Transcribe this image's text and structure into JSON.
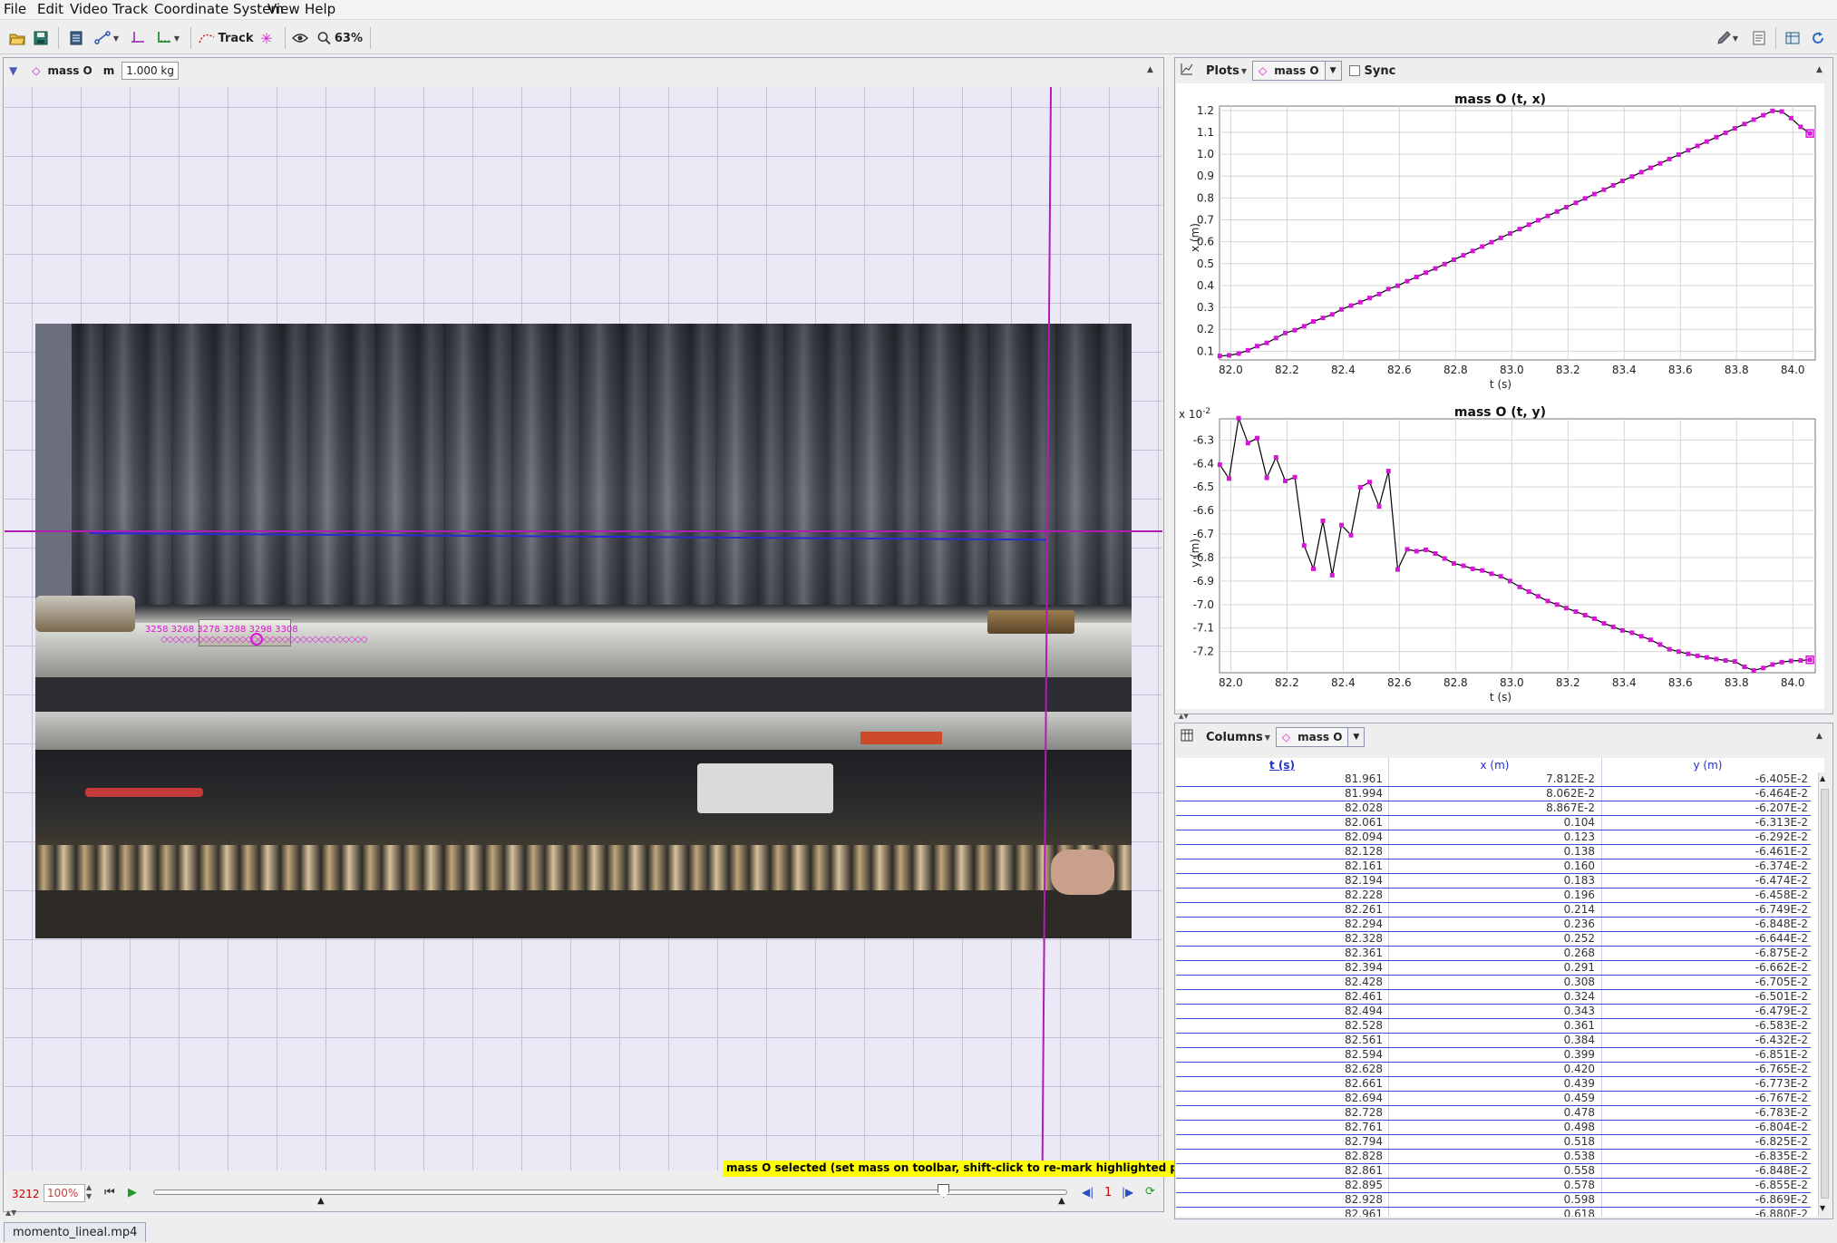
{
  "menubar": {
    "items": [
      "File",
      "Edit",
      "Video",
      "Track",
      "Coordinate System",
      "View",
      "Help"
    ]
  },
  "toolbar": {
    "track_label": "Track",
    "zoom_label": "63%"
  },
  "track_bar": {
    "track_name": "mass O",
    "mass_symbol": "m",
    "mass_value": "1.000 kg"
  },
  "canvas": {
    "point_labels": "3258 3268 3278 3288 3298 3308",
    "status_hint": "mass O selected (set mass on toolbar, shift-click to re-mark highlighted position)"
  },
  "player": {
    "frame_number": "3212",
    "rate": "100%",
    "step_size": "1"
  },
  "file_tab": "momento_lineal.mp4",
  "plots_bar": {
    "menu_label": "Plots",
    "track_name": "mass O",
    "sync_label": "Sync"
  },
  "columns_bar": {
    "menu_label": "Columns",
    "track_name": "mass O"
  },
  "plot1": {
    "title": "mass O (t, x)",
    "xlabel": "t (s)",
    "ylabel": "x (m)"
  },
  "plot2": {
    "title": "mass O (t, y)",
    "xlabel": "t (s)",
    "ylabel": "y (m)",
    "exponent_base": "x 10",
    "exponent_power": "-2"
  },
  "table": {
    "headers": [
      "t (s)",
      "x (m)",
      "y (m)"
    ],
    "rows": [
      [
        "81.961",
        "7.812E-2",
        "-6.405E-2"
      ],
      [
        "81.994",
        "8.062E-2",
        "-6.464E-2"
      ],
      [
        "82.028",
        "8.867E-2",
        "-6.207E-2"
      ],
      [
        "82.061",
        "0.104",
        "-6.313E-2"
      ],
      [
        "82.094",
        "0.123",
        "-6.292E-2"
      ],
      [
        "82.128",
        "0.138",
        "-6.461E-2"
      ],
      [
        "82.161",
        "0.160",
        "-6.374E-2"
      ],
      [
        "82.194",
        "0.183",
        "-6.474E-2"
      ],
      [
        "82.228",
        "0.196",
        "-6.458E-2"
      ],
      [
        "82.261",
        "0.214",
        "-6.749E-2"
      ],
      [
        "82.294",
        "0.236",
        "-6.848E-2"
      ],
      [
        "82.328",
        "0.252",
        "-6.644E-2"
      ],
      [
        "82.361",
        "0.268",
        "-6.875E-2"
      ],
      [
        "82.394",
        "0.291",
        "-6.662E-2"
      ],
      [
        "82.428",
        "0.308",
        "-6.705E-2"
      ],
      [
        "82.461",
        "0.324",
        "-6.501E-2"
      ],
      [
        "82.494",
        "0.343",
        "-6.479E-2"
      ],
      [
        "82.528",
        "0.361",
        "-6.583E-2"
      ],
      [
        "82.561",
        "0.384",
        "-6.432E-2"
      ],
      [
        "82.594",
        "0.399",
        "-6.851E-2"
      ],
      [
        "82.628",
        "0.420",
        "-6.765E-2"
      ],
      [
        "82.661",
        "0.439",
        "-6.773E-2"
      ],
      [
        "82.694",
        "0.459",
        "-6.767E-2"
      ],
      [
        "82.728",
        "0.478",
        "-6.783E-2"
      ],
      [
        "82.761",
        "0.498",
        "-6.804E-2"
      ],
      [
        "82.794",
        "0.518",
        "-6.825E-2"
      ],
      [
        "82.828",
        "0.538",
        "-6.835E-2"
      ],
      [
        "82.861",
        "0.558",
        "-6.848E-2"
      ],
      [
        "82.895",
        "0.578",
        "-6.855E-2"
      ],
      [
        "82.928",
        "0.598",
        "-6.869E-2"
      ],
      [
        "82.961",
        "0.618",
        "-6.880E-2"
      ]
    ]
  },
  "chart_data": [
    {
      "type": "line",
      "title": "mass O (t, x)",
      "xlabel": "t (s)",
      "ylabel": "x (m)",
      "xlim": [
        81.96,
        84.08
      ],
      "ylim": [
        0.06,
        1.22
      ],
      "xticks": [
        "82.0",
        "82.2",
        "82.4",
        "82.6",
        "82.8",
        "83.0",
        "83.2",
        "83.4",
        "83.6",
        "83.8",
        "84.0"
      ],
      "yticks": [
        "0.1",
        "0.2",
        "0.3",
        "0.4",
        "0.5",
        "0.6",
        "0.7",
        "0.8",
        "0.9",
        "1.0",
        "1.1",
        "1.2"
      ],
      "grid": true,
      "x": [
        81.961,
        81.994,
        82.028,
        82.061,
        82.094,
        82.128,
        82.161,
        82.194,
        82.228,
        82.261,
        82.294,
        82.328,
        82.361,
        82.394,
        82.428,
        82.461,
        82.494,
        82.528,
        82.561,
        82.594,
        82.628,
        82.661,
        82.694,
        82.728,
        82.761,
        82.794,
        82.828,
        82.861,
        82.895,
        82.928,
        82.961,
        82.994,
        83.028,
        83.061,
        83.094,
        83.128,
        83.161,
        83.194,
        83.228,
        83.261,
        83.294,
        83.328,
        83.361,
        83.394,
        83.428,
        83.461,
        83.494,
        83.528,
        83.561,
        83.594,
        83.628,
        83.661,
        83.694,
        83.728,
        83.761,
        83.794,
        83.828,
        83.861,
        83.895,
        83.928,
        83.961,
        83.994,
        84.028,
        84.061
      ],
      "y": [
        0.078,
        0.081,
        0.089,
        0.104,
        0.123,
        0.138,
        0.16,
        0.183,
        0.196,
        0.214,
        0.236,
        0.252,
        0.268,
        0.291,
        0.308,
        0.324,
        0.343,
        0.361,
        0.384,
        0.399,
        0.42,
        0.439,
        0.459,
        0.478,
        0.498,
        0.518,
        0.538,
        0.558,
        0.578,
        0.598,
        0.618,
        0.638,
        0.658,
        0.678,
        0.698,
        0.718,
        0.738,
        0.758,
        0.778,
        0.798,
        0.818,
        0.838,
        0.858,
        0.878,
        0.898,
        0.918,
        0.938,
        0.958,
        0.978,
        0.998,
        1.018,
        1.038,
        1.058,
        1.078,
        1.098,
        1.118,
        1.138,
        1.158,
        1.178,
        1.198,
        1.195,
        1.165,
        1.125,
        1.095
      ]
    },
    {
      "type": "line",
      "title": "mass O (t, y)",
      "xlabel": "t (s)",
      "ylabel": "y (m)",
      "xlim": [
        81.96,
        84.08
      ],
      "ylim": [
        -7.29,
        -6.21
      ],
      "y_multiplier": "x 10^-2",
      "xticks": [
        "82.0",
        "82.2",
        "82.4",
        "82.6",
        "82.8",
        "83.0",
        "83.2",
        "83.4",
        "83.6",
        "83.8",
        "84.0"
      ],
      "yticks": [
        "-6.3",
        "-6.4",
        "-6.5",
        "-6.6",
        "-6.7",
        "-6.8",
        "-6.9",
        "-7.0",
        "-7.1",
        "-7.2"
      ],
      "grid": true,
      "x": [
        81.961,
        81.994,
        82.028,
        82.061,
        82.094,
        82.128,
        82.161,
        82.194,
        82.228,
        82.261,
        82.294,
        82.328,
        82.361,
        82.394,
        82.428,
        82.461,
        82.494,
        82.528,
        82.561,
        82.594,
        82.628,
        82.661,
        82.694,
        82.728,
        82.761,
        82.794,
        82.828,
        82.861,
        82.895,
        82.928,
        82.961,
        82.994,
        83.028,
        83.061,
        83.094,
        83.128,
        83.161,
        83.194,
        83.228,
        83.261,
        83.294,
        83.328,
        83.361,
        83.394,
        83.428,
        83.461,
        83.494,
        83.528,
        83.561,
        83.594,
        83.628,
        83.661,
        83.694,
        83.728,
        83.761,
        83.794,
        83.828,
        83.861,
        83.895,
        83.928,
        83.961,
        83.994,
        84.028,
        84.061
      ],
      "y": [
        -6.405,
        -6.464,
        -6.207,
        -6.313,
        -6.292,
        -6.461,
        -6.374,
        -6.474,
        -6.458,
        -6.749,
        -6.848,
        -6.644,
        -6.875,
        -6.662,
        -6.705,
        -6.501,
        -6.479,
        -6.583,
        -6.432,
        -6.851,
        -6.765,
        -6.773,
        -6.767,
        -6.783,
        -6.804,
        -6.825,
        -6.835,
        -6.848,
        -6.855,
        -6.869,
        -6.88,
        -6.9,
        -6.925,
        -6.945,
        -6.965,
        -6.985,
        -7.0,
        -7.015,
        -7.03,
        -7.045,
        -7.06,
        -7.08,
        -7.095,
        -7.11,
        -7.12,
        -7.135,
        -7.15,
        -7.17,
        -7.19,
        -7.2,
        -7.21,
        -7.218,
        -7.225,
        -7.232,
        -7.238,
        -7.242,
        -7.265,
        -7.28,
        -7.27,
        -7.255,
        -7.245,
        -7.24,
        -7.238,
        -7.235
      ]
    }
  ]
}
